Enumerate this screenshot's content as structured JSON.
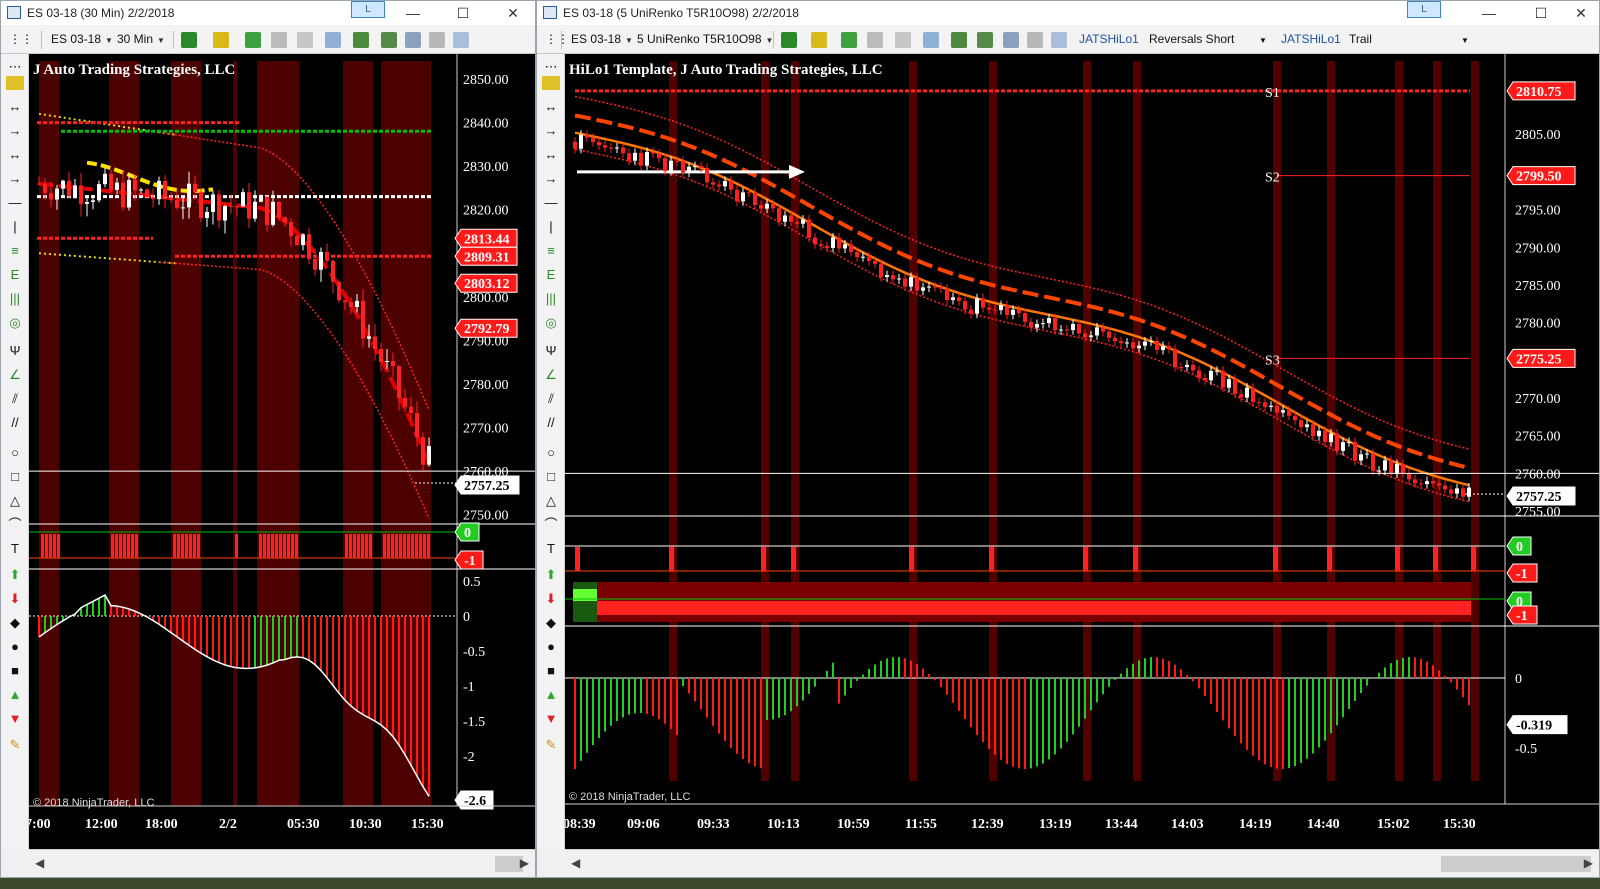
{
  "left_window": {
    "title": "ES 03-18 (30 Min)  2/2/2018",
    "l_button": "L",
    "controls": {
      "minimize": "—",
      "maximize": "☐",
      "close": "✕"
    },
    "toolbar": {
      "instrument": "ES 03-18",
      "interval": "30 Min"
    },
    "chart_title": "J Auto Trading Strategies, LLC",
    "copyright": "© 2018 NinjaTrader, LLC",
    "price_labels": [
      "2850.00",
      "2840.00",
      "2830.00",
      "2820.00",
      "2810.00",
      "2800.00",
      "2790.00",
      "2780.00",
      "2770.00",
      "2760.00",
      "2750.00"
    ],
    "price_badges": [
      {
        "text": "2813.44",
        "color": "#ff1a1a"
      },
      {
        "text": "2809.31",
        "color": "#ff1a1a"
      },
      {
        "text": "2803.12",
        "color": "#ff1a1a"
      },
      {
        "text": "2792.79",
        "color": "#ff1a1a"
      }
    ],
    "last_price": "2757.25",
    "signal_badges": [
      "0",
      "-1"
    ],
    "osc_labels": [
      "0.5",
      "0",
      "-0.5",
      "-1",
      "-1.5",
      "-2"
    ],
    "osc_value": "-2.6",
    "x_labels": [
      "7:00",
      "12:00",
      "18:00",
      "2/2",
      "05:30",
      "10:30",
      "15:30"
    ]
  },
  "right_window": {
    "title": "ES 03-18 (5 UniRenko T5R10O98)  2/2/2018",
    "l_button": "L",
    "controls": {
      "minimize": "—",
      "maximize": "☐",
      "close": "✕"
    },
    "toolbar": {
      "instrument": "ES 03-18",
      "interval": "5 UniRenko T5R10O98",
      "indicator1": "JATSHiLo1",
      "mode1": "Reversals Short",
      "indicator2": "JATSHiLo1",
      "mode2": "Trail"
    },
    "chart_title": "HiLo1 Template, J Auto Trading Strategies, LLC",
    "copyright": "© 2018 NinjaTrader, LLC",
    "price_labels": [
      "2805.00",
      "2800.00",
      "2795.00",
      "2790.00",
      "2785.00",
      "2780.00",
      "2775.00",
      "2770.00",
      "2765.00",
      "2760.00",
      "2755.00"
    ],
    "price_badges": [
      {
        "text": "2810.75",
        "color": "#ff1a1a"
      },
      {
        "text": "2799.50",
        "color": "#ff1a1a"
      },
      {
        "text": "2775.25",
        "color": "#ff1a1a"
      }
    ],
    "level_labels": [
      "S1",
      "S2",
      "S3"
    ],
    "last_price": "2757.25",
    "signal_badges": [
      "0",
      "-1",
      "0",
      "-1"
    ],
    "osc_labels": [
      "0",
      "-0.5"
    ],
    "osc_value": "-0.319",
    "x_labels": [
      "08:39",
      "09:06",
      "09:33",
      "10:13",
      "10:59",
      "11:55",
      "12:39",
      "13:19",
      "13:44",
      "14:03",
      "14:19",
      "14:40",
      "15:02",
      "15:30"
    ]
  },
  "colors": {
    "bull": "#ffffff",
    "bear": "#ff2020",
    "osc_up": "#22cc22",
    "osc_down": "#ff1a1a",
    "band": "#ff4400",
    "ma": "#ff7700",
    "session_shade": "#5a0000"
  }
}
